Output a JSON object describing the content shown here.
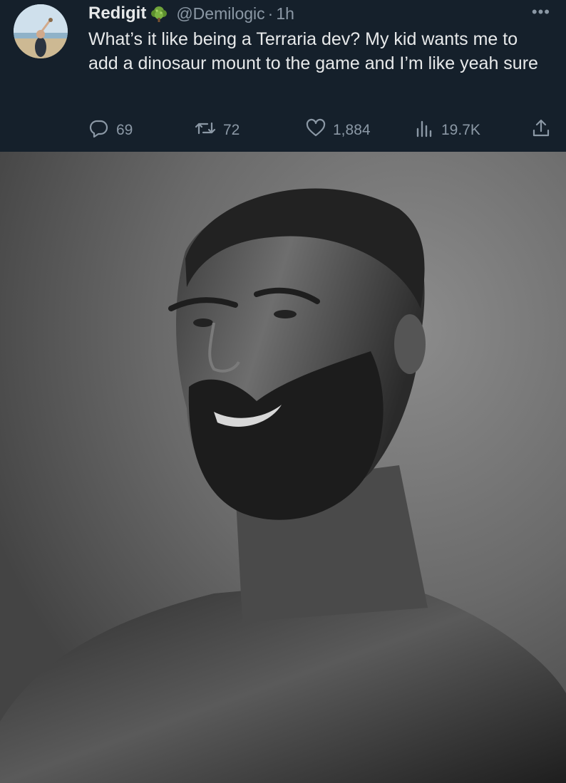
{
  "tweet": {
    "display_name": "Redigit",
    "handle": "@Demilogic",
    "separator": "·",
    "time": "1h",
    "more_label": "•••",
    "text": "What’s it like being a Terraria dev? My kid wants me to add a dinosaur mount to the game and I’m like yeah sure",
    "avatar_icon": "avatar-photo-icon",
    "badge_icon": "green-tree-badge-icon"
  },
  "actions": {
    "replies": "69",
    "reposts": "72",
    "likes": "1,884",
    "views": "19.7K",
    "reply_icon": "reply-icon",
    "repost_icon": "repost-icon",
    "like_icon": "heart-icon",
    "views_icon": "views-icon",
    "share_icon": "share-icon"
  },
  "media": {
    "description_icon": "grayscale-bearded-man-photo"
  },
  "colors": {
    "background": "#15202b",
    "text_primary": "#e7e9ea",
    "text_secondary": "#8b98a5",
    "badge_green": "#6fa33a"
  }
}
